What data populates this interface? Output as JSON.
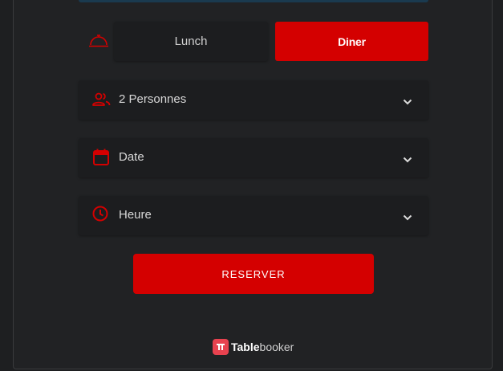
{
  "service": {
    "icon": "cloche-icon",
    "options": [
      {
        "label": "Lunch",
        "selected": false
      },
      {
        "label": "Diner",
        "selected": true
      }
    ]
  },
  "fields": {
    "guests": {
      "icon": "people-icon",
      "label": "2 Personnes"
    },
    "date": {
      "icon": "calendar-icon",
      "label": "Date"
    },
    "time": {
      "icon": "clock-icon",
      "label": "Heure"
    }
  },
  "reserve_button": {
    "label": "RESERVER"
  },
  "branding": {
    "name_bold": "Table",
    "name_light": "booker",
    "icon": "tablebooker-logo"
  },
  "colors": {
    "accent": "#d40000",
    "background": "#1e1f21",
    "field": "#1c1d1f"
  }
}
